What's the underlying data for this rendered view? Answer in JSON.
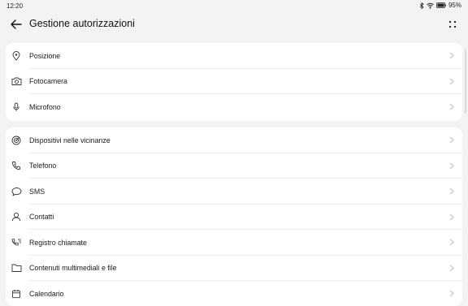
{
  "status": {
    "time": "12:20",
    "battery": "95%"
  },
  "header": {
    "title": "Gestione autorizzazioni"
  },
  "group1": [
    {
      "label": "Posizione",
      "icon": "location-pin-icon"
    },
    {
      "label": "Fotocamera",
      "icon": "camera-icon"
    },
    {
      "label": "Microfono",
      "icon": "microphone-icon"
    }
  ],
  "group2": [
    {
      "label": "Dispositivi nelle vicinanze",
      "icon": "nearby-devices-icon"
    },
    {
      "label": "Telefono",
      "icon": "phone-icon"
    },
    {
      "label": "SMS",
      "icon": "sms-icon"
    },
    {
      "label": "Contatti",
      "icon": "contacts-icon"
    },
    {
      "label": "Registro chiamate",
      "icon": "call-log-icon"
    },
    {
      "label": "Contenuti multimediali e file",
      "icon": "folder-icon"
    },
    {
      "label": "Calendario",
      "icon": "calendar-icon"
    }
  ]
}
